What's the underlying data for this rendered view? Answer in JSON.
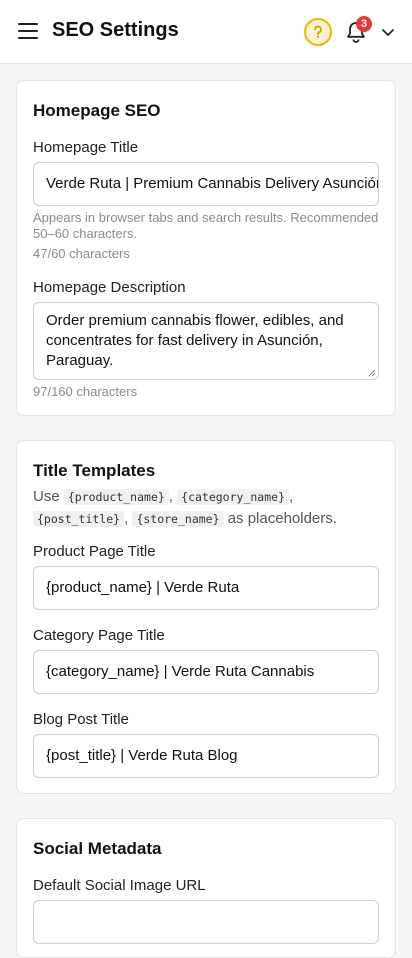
{
  "header": {
    "title": "SEO Settings",
    "notification_count": "3",
    "accent_color": "#f0b400",
    "badge_color": "#e53935"
  },
  "homepage_seo": {
    "title": "Homepage SEO",
    "title_label": "Homepage Title",
    "title_value": "Verde Ruta | Premium Cannabis Delivery Asunción",
    "title_hint": "Appears in browser tabs and search results. Recommended 50–60 characters.",
    "title_count": "47/60 characters",
    "description_label": "Homepage Description",
    "description_value": "Order premium cannabis flower, edibles, and concentrates for fast delivery in Asunción, Paraguay.",
    "description_count": "97/160 characters"
  },
  "title_templates": {
    "title": "Title Templates",
    "desc_prefix": "Use",
    "placeholders": [
      "{product_name}",
      "{category_name}",
      "{post_title}",
      "{store_name}"
    ],
    "sep1": ",",
    "sep2": ",",
    "sep3": ",",
    "desc_suffix": "as placeholders.",
    "product_label": "Product Page Title",
    "product_value": "{product_name} | Verde Ruta",
    "category_label": "Category Page Title",
    "category_value": "{category_name} | Verde Ruta Cannabis",
    "blog_label": "Blog Post Title",
    "blog_value": "{post_title} | Verde Ruta Blog"
  },
  "social_metadata": {
    "title": "Social Metadata",
    "image_label": "Default Social Image URL"
  }
}
